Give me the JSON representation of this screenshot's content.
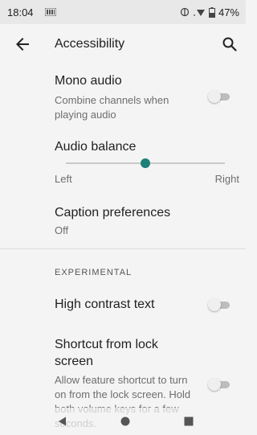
{
  "status_bar": {
    "time": "18:04",
    "battery": "47%"
  },
  "app_bar": {
    "title": "Accessibility"
  },
  "settings": {
    "mono_audio": {
      "title": "Mono audio",
      "summary": "Combine channels when playing audio",
      "enabled": false
    },
    "audio_balance": {
      "title": "Audio balance",
      "left_label": "Left",
      "right_label": "Right",
      "value": 0.5
    },
    "caption_preferences": {
      "title": "Caption preferences",
      "summary": "Off"
    },
    "experimental_header": "EXPERIMENTAL",
    "high_contrast_text": {
      "title": "High contrast text",
      "enabled": false
    },
    "shortcut_lock_screen": {
      "title": "Shortcut from lock screen",
      "summary": "Allow feature shortcut to turn on from the lock screen. Hold both volume keys for a few seconds.",
      "enabled": false
    }
  },
  "icons": {
    "back": "arrow-back-icon",
    "search": "search-icon",
    "nav_back": "nav-back-triangle-icon",
    "nav_home": "nav-home-circle-icon",
    "nav_recents": "nav-recents-square-icon"
  },
  "colors": {
    "accent": "#1e8076",
    "background": "#f4f4f4",
    "status_bar": "#e8e8e8"
  }
}
